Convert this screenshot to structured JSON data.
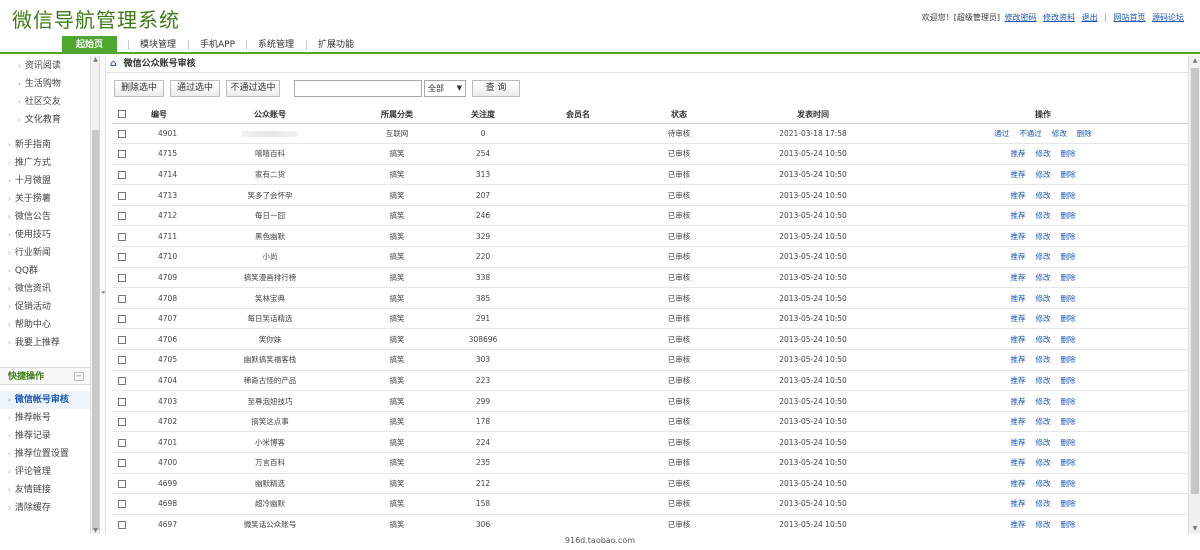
{
  "app": {
    "title": "微信导航管理系统",
    "welcome": "欢迎您！[超级管理员]",
    "links": [
      "修改密码",
      "修改资料",
      "退出",
      "网站首页",
      "源码论坛"
    ]
  },
  "nav": {
    "tabs": [
      "起始页",
      "模块管理",
      "手机APP",
      "系统管理",
      "扩展功能"
    ]
  },
  "sidebar": {
    "top_items": [
      "资讯阅读",
      "生活购物",
      "社区交友",
      "文化教育"
    ],
    "items": [
      "新手指南",
      "推广方式",
      "十月微盟",
      "关于捞薯",
      "微信公告",
      "使用技巧",
      "行业新闻",
      "QQ群",
      "微信资讯",
      "促销活动",
      "帮助中心",
      "我要上推荐"
    ],
    "quick_title": "快捷操作",
    "quick_items": [
      "微信帐号审核",
      "推荐帐号",
      "推荐记录",
      "推荐位置设置",
      "评论管理",
      "友情链接",
      "清除缓存"
    ]
  },
  "main": {
    "breadcrumb": "微信公众账号审核",
    "buttons": {
      "delete": "删除选中",
      "approve": "通过选中",
      "reject": "不通过选中",
      "query": "查 询"
    },
    "search": {
      "value": "",
      "placeholder": ""
    },
    "filter_selected": "全部",
    "columns": [
      "编号",
      "公众账号",
      "所属分类",
      "关注度",
      "会员名",
      "状态",
      "发表时间",
      "操作"
    ],
    "rows": [
      {
        "id": "4901",
        "name": "",
        "category": "互联网",
        "follows": "0",
        "member": "",
        "status": "待审核",
        "time": "2021-03-18 17:58",
        "ops": [
          "通过",
          "不通过",
          "修改",
          "删除"
        ]
      },
      {
        "id": "4715",
        "name": "嘻嘻百科",
        "category": "搞笑",
        "follows": "254",
        "member": "",
        "status": "已审核",
        "time": "2013-05-24 10:50",
        "ops": [
          "推荐",
          "修改",
          "删除"
        ]
      },
      {
        "id": "4714",
        "name": "家有二货",
        "category": "搞笑",
        "follows": "313",
        "member": "",
        "status": "已审核",
        "time": "2013-05-24 10:50",
        "ops": [
          "推荐",
          "修改",
          "删除"
        ]
      },
      {
        "id": "4713",
        "name": "笑多了会怀孕",
        "category": "搞笑",
        "follows": "207",
        "member": "",
        "status": "已审核",
        "time": "2013-05-24 10:50",
        "ops": [
          "推荐",
          "修改",
          "删除"
        ]
      },
      {
        "id": "4712",
        "name": "每日一囧",
        "category": "搞笑",
        "follows": "246",
        "member": "",
        "status": "已审核",
        "time": "2013-05-24 10:50",
        "ops": [
          "推荐",
          "修改",
          "删除"
        ]
      },
      {
        "id": "4711",
        "name": "黑色幽默",
        "category": "搞笑",
        "follows": "329",
        "member": "",
        "status": "已审核",
        "time": "2013-05-24 10:50",
        "ops": [
          "推荐",
          "修改",
          "删除"
        ]
      },
      {
        "id": "4710",
        "name": "小尚",
        "category": "搞笑",
        "follows": "220",
        "member": "",
        "status": "已审核",
        "time": "2013-05-24 10:50",
        "ops": [
          "推荐",
          "修改",
          "删除"
        ]
      },
      {
        "id": "4709",
        "name": "搞笑漫画排行榜",
        "category": "搞笑",
        "follows": "338",
        "member": "",
        "status": "已审核",
        "time": "2013-05-24 10:50",
        "ops": [
          "推荐",
          "修改",
          "删除"
        ]
      },
      {
        "id": "4708",
        "name": "笑林宝典",
        "category": "搞笑",
        "follows": "385",
        "member": "",
        "status": "已审核",
        "time": "2013-05-24 10:50",
        "ops": [
          "推荐",
          "修改",
          "删除"
        ]
      },
      {
        "id": "4707",
        "name": "每日笑话精选",
        "category": "搞笑",
        "follows": "291",
        "member": "",
        "status": "已审核",
        "time": "2013-05-24 10:50",
        "ops": [
          "推荐",
          "修改",
          "删除"
        ]
      },
      {
        "id": "4706",
        "name": "笑你妹",
        "category": "搞笑",
        "follows": "308696",
        "member": "",
        "status": "已审核",
        "time": "2013-05-24 10:50",
        "ops": [
          "推荐",
          "修改",
          "删除"
        ]
      },
      {
        "id": "4705",
        "name": "幽默搞笑福客栈",
        "category": "搞笑",
        "follows": "303",
        "member": "",
        "status": "已审核",
        "time": "2013-05-24 10:50",
        "ops": [
          "推荐",
          "修改",
          "删除"
        ]
      },
      {
        "id": "4704",
        "name": "稀奇古怪的产品",
        "category": "搞笑",
        "follows": "223",
        "member": "",
        "status": "已审核",
        "time": "2013-05-24 10:50",
        "ops": [
          "推荐",
          "修改",
          "删除"
        ]
      },
      {
        "id": "4703",
        "name": "至尊泡妞技巧",
        "category": "搞笑",
        "follows": "299",
        "member": "",
        "status": "已审核",
        "time": "2013-05-24 10:50",
        "ops": [
          "推荐",
          "修改",
          "删除"
        ]
      },
      {
        "id": "4702",
        "name": "搞笑这点事",
        "category": "搞笑",
        "follows": "178",
        "member": "",
        "status": "已审核",
        "time": "2013-05-24 10:50",
        "ops": [
          "推荐",
          "修改",
          "删除"
        ]
      },
      {
        "id": "4701",
        "name": "小米博客",
        "category": "搞笑",
        "follows": "224",
        "member": "",
        "status": "已审核",
        "time": "2013-05-24 10:50",
        "ops": [
          "推荐",
          "修改",
          "删除"
        ]
      },
      {
        "id": "4700",
        "name": "万言百科",
        "category": "搞笑",
        "follows": "235",
        "member": "",
        "status": "已审核",
        "time": "2013-05-24 10:50",
        "ops": [
          "推荐",
          "修改",
          "删除"
        ]
      },
      {
        "id": "4699",
        "name": "幽默精选",
        "category": "搞笑",
        "follows": "212",
        "member": "",
        "status": "已审核",
        "time": "2013-05-24 10:50",
        "ops": [
          "推荐",
          "修改",
          "删除"
        ]
      },
      {
        "id": "4698",
        "name": "超冷幽默",
        "category": "搞笑",
        "follows": "158",
        "member": "",
        "status": "已审核",
        "time": "2013-05-24 10:50",
        "ops": [
          "推荐",
          "修改",
          "删除"
        ]
      },
      {
        "id": "4697",
        "name": "微笑话公众账号",
        "category": "搞笑",
        "follows": "306",
        "member": "",
        "status": "已审核",
        "time": "2013-05-24 10:50",
        "ops": [
          "推荐",
          "修改",
          "删除"
        ]
      }
    ]
  },
  "footer": {
    "text": "916d.taobao.com"
  },
  "colors": {
    "brand": "#3c7d17",
    "nav_active": "#4ea72e",
    "link": "#1a56b8"
  }
}
